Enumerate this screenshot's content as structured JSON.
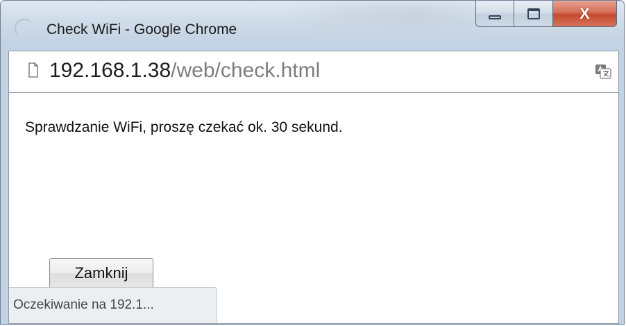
{
  "window": {
    "title": "Check WiFi - Google Chrome",
    "controls": {
      "close_label": "X"
    }
  },
  "address_bar": {
    "url_host": "192.168.1.38",
    "url_path": "/web/check.html"
  },
  "page": {
    "message": "Sprawdzanie WiFi, proszę czekać ok. 30 sekund.",
    "close_button_label": "Zamknij"
  },
  "status_bar": {
    "text": "Oczekiwanie na 192.1..."
  },
  "colors": {
    "frame": "#c4d3e3",
    "close_button": "#c74a31",
    "url_path": "#7d7d7d"
  },
  "icons": {
    "app": "chrome-loading-icon",
    "page": "document-icon",
    "translate": "translate-icon"
  }
}
